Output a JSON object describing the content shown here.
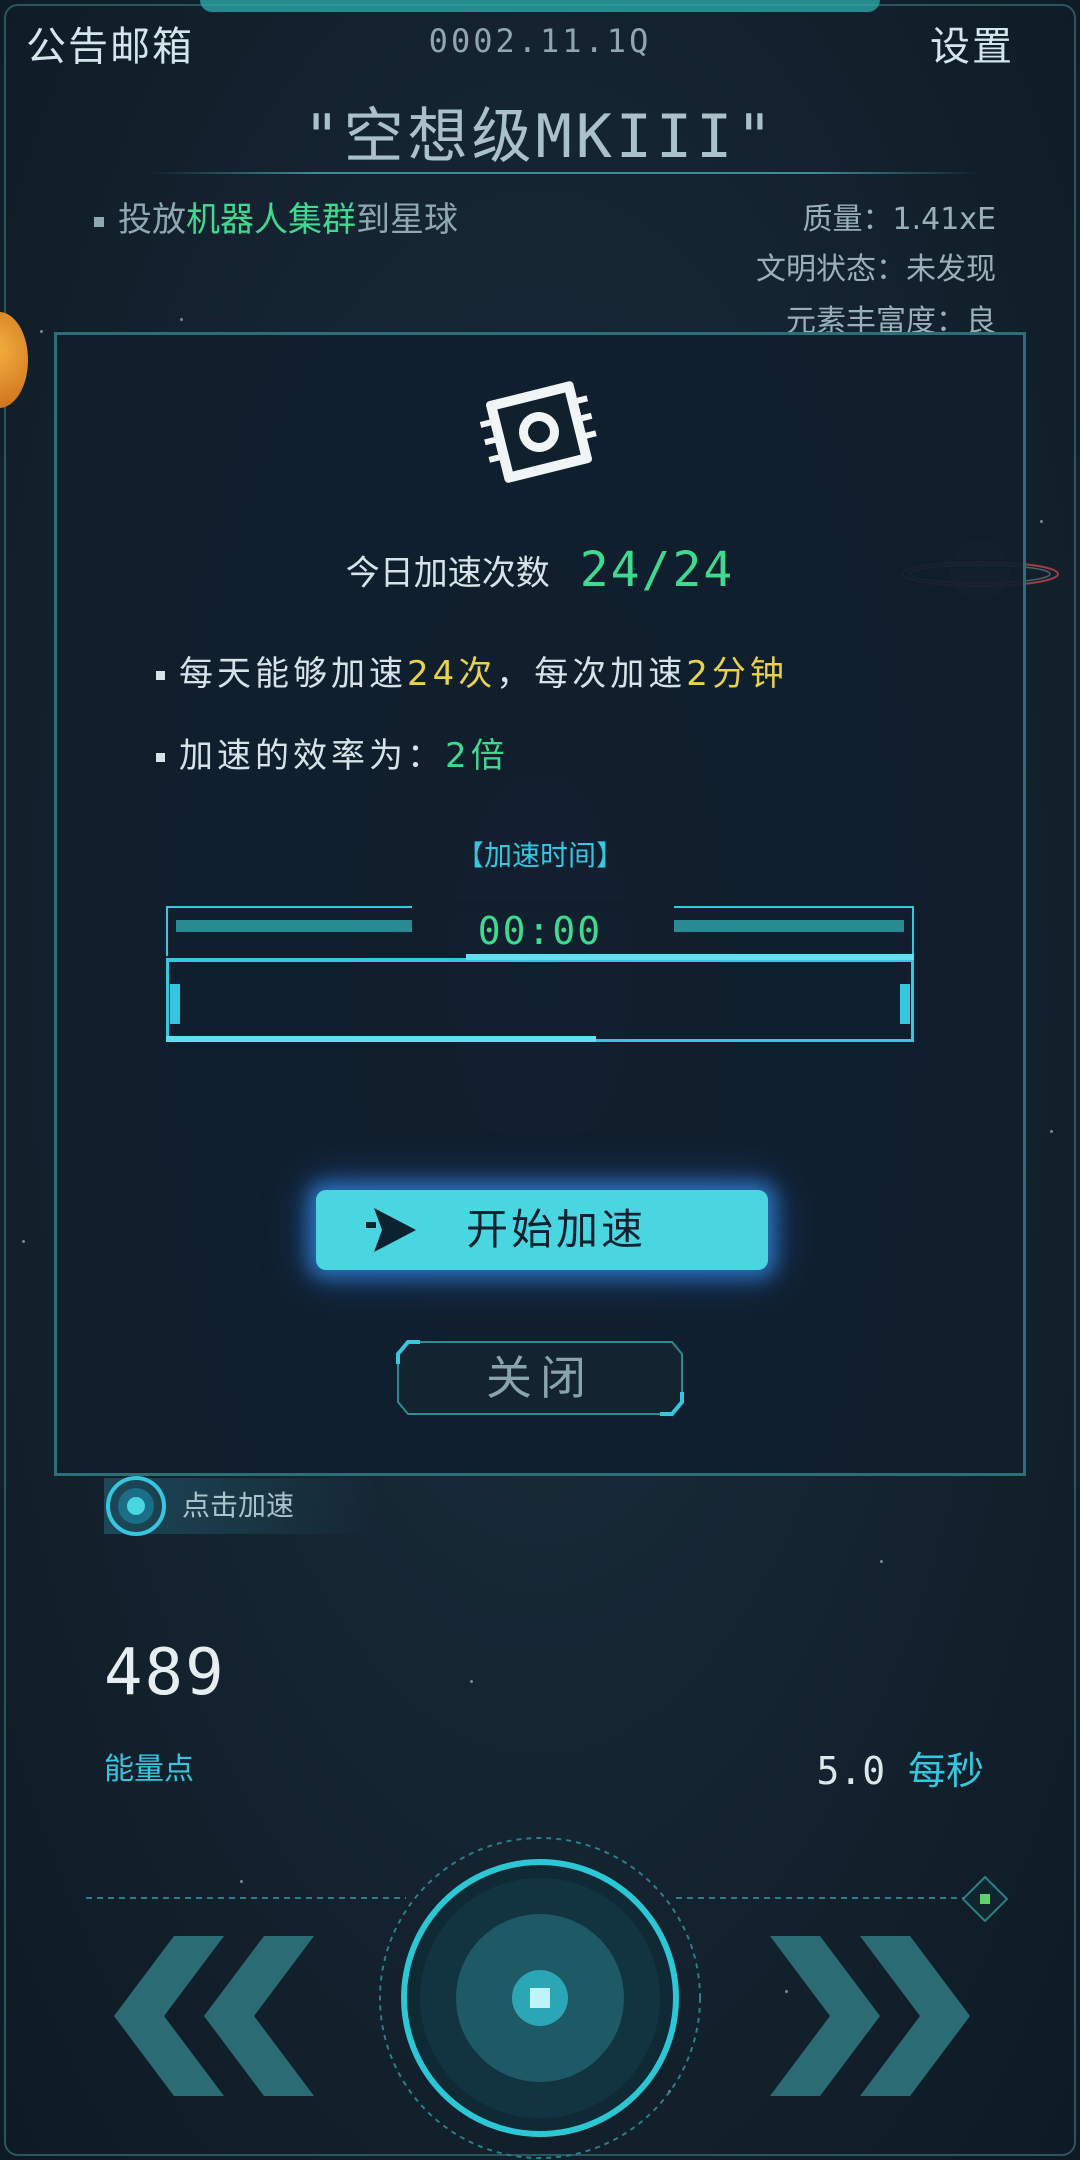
{
  "header": {
    "mailbox": "公告邮箱",
    "date": "0002.11.1Q",
    "settings": "设置"
  },
  "ship_name": "\"空想级MKIII\"",
  "mission": {
    "prefix": "投放",
    "highlight": "机器人集群",
    "suffix": "到星球"
  },
  "planet_stats": {
    "mass": "质量：1.41xE",
    "civilization": "文明状态：未发现",
    "richness": "元素丰富度：良"
  },
  "boost_dialog": {
    "today_label": "今日加速次数",
    "today_value": "24/24",
    "rule1": {
      "a": "每天能够加速",
      "b": "24次",
      "c": "，每次加速",
      "d": "2分钟"
    },
    "rule2": {
      "a": "加速的效率为：",
      "b": "2倍"
    },
    "time_title": "【加速时间】",
    "time_value": "00:00",
    "start_button": "开始加速",
    "close_button": "关闭"
  },
  "click_boost": "点击加速",
  "energy": {
    "value": "489",
    "label": "能量点",
    "rate_value": "5.0",
    "rate_unit": "每秒"
  },
  "colors": {
    "accent": "#36c6e0",
    "green": "#3fd98f",
    "yellow": "#e8d24a",
    "button": "#4ad6e0"
  }
}
